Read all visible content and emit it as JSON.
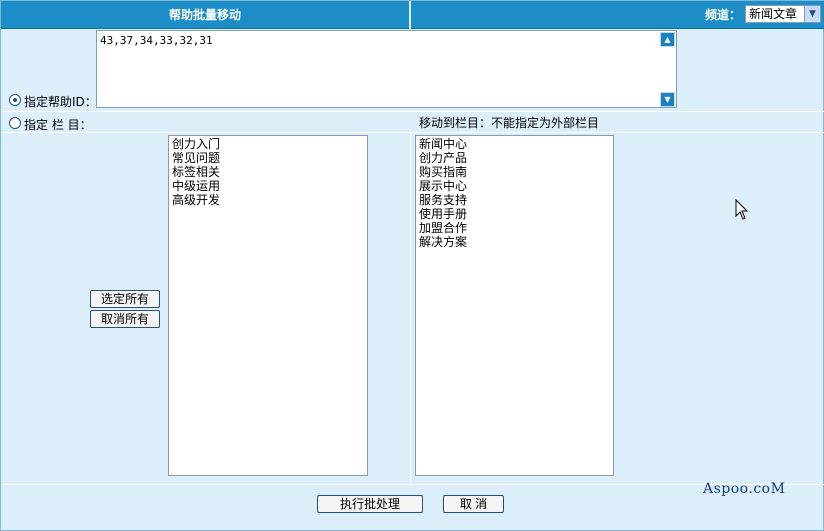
{
  "header": {
    "title": "帮助批量移动",
    "channel_label": "频道：",
    "channel_value": "新闻文章"
  },
  "ids": {
    "label": "指定帮助ID：",
    "value": "43,37,34,33,32,31",
    "selected": true
  },
  "category": {
    "label": "指定 栏 目：",
    "selected": false
  },
  "target": {
    "label": "移动到栏目：不能指定为外部栏目"
  },
  "source_list": [
    "创力入门",
    "常见问题",
    "标签相关",
    "中级运用",
    "高级开发"
  ],
  "target_list": [
    "新闻中心",
    "创力产品",
    "购买指南",
    "展示中心",
    "服务支持",
    "使用手册",
    "加盟合作",
    "解决方案"
  ],
  "buttons": {
    "select_all": "选定所有",
    "deselect_all": "取消所有",
    "execute": "执行批处理",
    "cancel": "取 消"
  },
  "watermark": "Aspoo.coM",
  "colors": {
    "header": "#1d8dc8",
    "panel": "#dbeef9",
    "border": "#7f9db9"
  }
}
